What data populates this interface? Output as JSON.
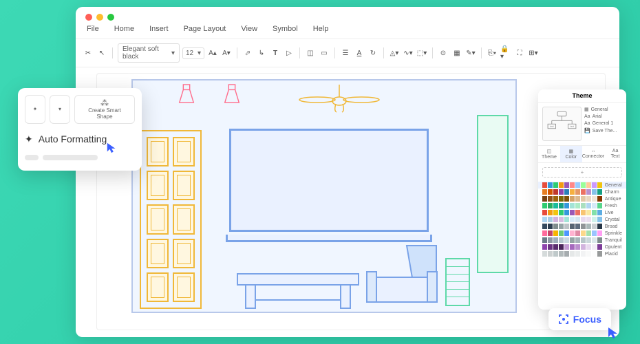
{
  "menu": {
    "file": "File",
    "home": "Home",
    "insert": "Insert",
    "pageLayout": "Page Layout",
    "view": "View",
    "symbol": "Symbol",
    "help": "Help"
  },
  "toolbar": {
    "font": "Elegant soft black",
    "size": "12"
  },
  "popup": {
    "createSmart": "Create Smart\nShape",
    "autoFormat": "Auto Formatting"
  },
  "theme": {
    "title": "Theme",
    "info": {
      "general": "General",
      "font": "Arial",
      "general1": "General 1",
      "save": "Save The..."
    },
    "tabs": {
      "theme": "Theme",
      "color": "Color",
      "connector": "Connector",
      "text": "Text"
    },
    "palettes": [
      "General",
      "Charm",
      "Antique",
      "Fresh",
      "Live",
      "Crystal",
      "Broad",
      "Sprinkle",
      "Tranquil",
      "Opulent",
      "Placid"
    ]
  },
  "focus": {
    "label": "Focus"
  },
  "colors": {
    "General": [
      "#e74c3c",
      "#3498db",
      "#2ecc71",
      "#f39c12",
      "#9b59b6",
      "#f88",
      "#9cf",
      "#9f9",
      "#fc9",
      "#c9f",
      "#f1c40f"
    ],
    "Charm": [
      "#e67e22",
      "#d35400",
      "#c0392b",
      "#8e44ad",
      "#2980b9",
      "#f5b041",
      "#e59866",
      "#ec7063",
      "#bb8fce",
      "#85c1e9",
      "#16a085"
    ],
    "Antique": [
      "#784212",
      "#935116",
      "#9c640c",
      "#7d6608",
      "#7e5109",
      "#d5a36a",
      "#dcb88e",
      "#e3c7a7",
      "#e9d6c0",
      "#f0e5d8",
      "#873600"
    ],
    "Fresh": [
      "#2ecc71",
      "#27ae60",
      "#1abc9c",
      "#16a085",
      "#3498db",
      "#a3e4d7",
      "#abebc6",
      "#a9dfbf",
      "#aed6f1",
      "#d6eaf8",
      "#58d68d"
    ],
    "Live": [
      "#e74c3c",
      "#f39c12",
      "#f1c40f",
      "#2ecc71",
      "#3498db",
      "#9b59b6",
      "#ec7063",
      "#f8c471",
      "#f9e79f",
      "#82e0aa",
      "#5dade2"
    ],
    "Crystal": [
      "#aed6f1",
      "#a9cce3",
      "#d2b4de",
      "#d7bde2",
      "#a3e4d7",
      "#d6eaf8",
      "#d4e6f1",
      "#e8daef",
      "#ebdef0",
      "#d1f2eb",
      "#85c1e9"
    ],
    "Broad": [
      "#34495e",
      "#2c3e50",
      "#7f8c8d",
      "#95a5a6",
      "#bdc3c7",
      "#566573",
      "#5d6d7e",
      "#909497",
      "#aab7b8",
      "#cacfd2",
      "#283747"
    ],
    "Sprinkle": [
      "#ff6b9d",
      "#c44569",
      "#f8b500",
      "#6bcb77",
      "#4d96ff",
      "#ffb3d1",
      "#e08ba6",
      "#fcd88a",
      "#a5e0ac",
      "#9ac4ff",
      "#ff9ff3"
    ],
    "Tranquil": [
      "#6c7a89",
      "#8e9aa5",
      "#a0b0bc",
      "#b5c5cf",
      "#cad9e1",
      "#95a5a6",
      "#a6b5b9",
      "#b8c7ca",
      "#cad8db",
      "#dce8eb",
      "#7f8c8d"
    ],
    "Opulent": [
      "#8e44ad",
      "#6c3483",
      "#5b2c6f",
      "#4a235a",
      "#c39bd3",
      "#a569bd",
      "#bb8fce",
      "#d2b4de",
      "#e8daef",
      "#f4ecf7",
      "#7d3c98"
    ],
    "Placid": [
      "#d5dbdb",
      "#ccd1d1",
      "#bfc9ca",
      "#b2babb",
      "#a6acaf",
      "#e5e8e8",
      "#eaeded",
      "#f2f3f4",
      "#f8f9f9",
      "#fdfefe",
      "#979a9a"
    ]
  }
}
